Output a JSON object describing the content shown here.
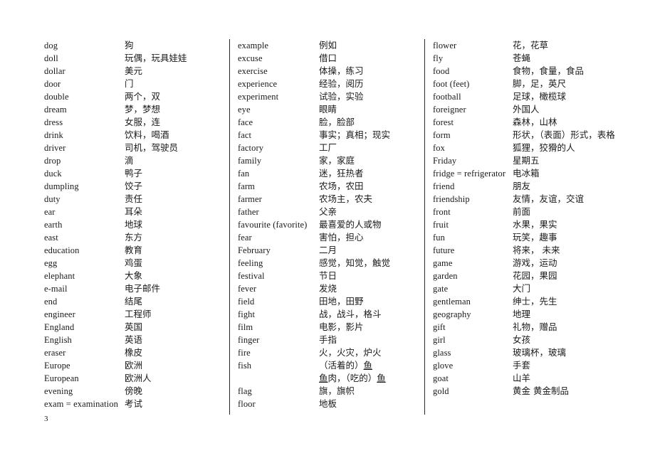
{
  "document": {
    "page_number": "3",
    "columns": [
      {
        "id": "column-1",
        "entries": [
          {
            "term": "dog",
            "gloss": "狗"
          },
          {
            "term": "doll",
            "gloss": "玩偶，玩具娃娃"
          },
          {
            "term": "dollar",
            "gloss": "美元"
          },
          {
            "term": "door",
            "gloss": "门"
          },
          {
            "term": "double",
            "gloss": "两个，双"
          },
          {
            "term": "dream",
            "gloss": "梦，梦想"
          },
          {
            "term": "dress",
            "gloss": "女服，连"
          },
          {
            "term": "drink",
            "gloss": "饮料，喝酒"
          },
          {
            "term": "driver",
            "gloss": "司机，驾驶员"
          },
          {
            "term": "drop",
            "gloss": "滴"
          },
          {
            "term": "duck",
            "gloss": "鸭子"
          },
          {
            "term": "dumpling",
            "gloss": "饺子"
          },
          {
            "term": "duty",
            "gloss": "责任"
          },
          {
            "term": "ear",
            "gloss": "耳朵"
          },
          {
            "term": "earth",
            "gloss": "地球"
          },
          {
            "term": "east",
            "gloss": "东方"
          },
          {
            "term": "education",
            "gloss": "教育"
          },
          {
            "term": "egg",
            "gloss": "鸡蛋"
          },
          {
            "term": "elephant",
            "gloss": "大象"
          },
          {
            "term": "e-mail",
            "gloss": "电子邮件"
          },
          {
            "term": "end",
            "gloss": "结尾"
          },
          {
            "term": "engineer",
            "gloss": "工程师"
          },
          {
            "term": "England",
            "gloss": "英国"
          },
          {
            "term": "English",
            "gloss": "英语"
          },
          {
            "term": "eraser",
            "gloss": "橡皮"
          },
          {
            "term": "Europe",
            "gloss": "欧洲"
          },
          {
            "term": "European",
            "gloss": "欧洲人"
          },
          {
            "term": "evening",
            "gloss": "傍晚"
          },
          {
            "term": "exam = examination",
            "gloss": "考试"
          }
        ]
      },
      {
        "id": "column-2",
        "entries": [
          {
            "term": "example",
            "gloss": "例如"
          },
          {
            "term": "excuse",
            "gloss": "借口"
          },
          {
            "term": "exercise",
            "gloss": "体操，练习"
          },
          {
            "term": "experience",
            "gloss": "经验，阅历"
          },
          {
            "term": "experiment",
            "gloss": "试验，实验"
          },
          {
            "term": "eye",
            "gloss": "眼睛"
          },
          {
            "term": "face",
            "gloss": "脸，脸部"
          },
          {
            "term": "fact",
            "gloss": "事实；真相；现实"
          },
          {
            "term": "factory",
            "gloss": "工厂"
          },
          {
            "term": "family",
            "gloss": "家，家庭"
          },
          {
            "term": "fan",
            "gloss": "迷，狂热者"
          },
          {
            "term": "farm",
            "gloss": "农场，农田"
          },
          {
            "term": "farmer",
            "gloss": "农场主，农夫"
          },
          {
            "term": "father",
            "gloss": "父亲"
          },
          {
            "term": "favourite (favorite)",
            "gloss": "最喜爱的人或物"
          },
          {
            "term": "fear",
            "gloss": "害怕，担心"
          },
          {
            "term": "February",
            "gloss": "二月"
          },
          {
            "term": "feeling",
            "gloss": "感觉，知觉，触觉"
          },
          {
            "term": "festival",
            "gloss": "节日"
          },
          {
            "term": "fever",
            "gloss": "发烧"
          },
          {
            "term": "field",
            "gloss": "田地，田野"
          },
          {
            "term": "fight",
            "gloss": "战，战斗，格斗"
          },
          {
            "term": "film",
            "gloss": "电影，影片"
          },
          {
            "term": "finger",
            "gloss": "手指"
          },
          {
            "term": "fire",
            "gloss": "火，火灾，炉火"
          },
          {
            "term": "fish",
            "gloss_parts": [
              {
                "text": "（活着的）",
                "underline": false
              },
              {
                "text": "鱼",
                "underline": true
              }
            ]
          },
          {
            "term": "",
            "continuation": true,
            "gloss_parts": [
              {
                "text": "鱼",
                "underline": true
              },
              {
                "text": "肉，（吃的）",
                "underline": false
              },
              {
                "text": "鱼",
                "underline": true
              }
            ]
          },
          {
            "term": "flag",
            "gloss": "旗，旗帜"
          },
          {
            "term": "floor",
            "gloss": "地板"
          }
        ]
      },
      {
        "id": "column-3",
        "entries": [
          {
            "term": "flower",
            "gloss": "花，花草"
          },
          {
            "term": "fly",
            "gloss": "苍蝇"
          },
          {
            "term": "food",
            "gloss": "食物，食量，食品"
          },
          {
            "term": "foot (feet)",
            "gloss": "脚，足，英尺"
          },
          {
            "term": "football",
            "gloss": "足球，橄榄球"
          },
          {
            "term": "foreigner",
            "gloss": "外国人"
          },
          {
            "term": "forest",
            "gloss": "森林，山林"
          },
          {
            "term": "form",
            "gloss": "形状，（表面）形式，表格"
          },
          {
            "term": "fox",
            "gloss": "狐狸，狡猾的人"
          },
          {
            "term": "Friday",
            "gloss": "星期五"
          },
          {
            "term": "fridge = refrigerator",
            "gloss": "电冰箱"
          },
          {
            "term": "friend",
            "gloss": "朋友"
          },
          {
            "term": "friendship",
            "gloss": "友情，友谊，交谊"
          },
          {
            "term": "front",
            "gloss": "前面"
          },
          {
            "term": "fruit",
            "gloss": "水果，果实"
          },
          {
            "term": "fun",
            "gloss": "玩笑，趣事"
          },
          {
            "term": "future",
            "gloss": "将来， 未来"
          },
          {
            "term": "game",
            "gloss": "游戏，运动"
          },
          {
            "term": "garden",
            "gloss": "花园，果园"
          },
          {
            "term": "gate",
            "gloss": "大门"
          },
          {
            "term": "gentleman",
            "gloss": "绅士，先生"
          },
          {
            "term": "geography",
            "gloss": "地理"
          },
          {
            "term": "gift",
            "gloss": "礼物，赠品"
          },
          {
            "term": "girl",
            "gloss": "女孩"
          },
          {
            "term": "glass",
            "gloss": "玻璃杯，玻璃"
          },
          {
            "term": "glove",
            "gloss": "手套"
          },
          {
            "term": "goat",
            "gloss": "山羊"
          },
          {
            "term": "gold",
            "gloss": "黄金 黄金制品"
          }
        ]
      }
    ]
  }
}
